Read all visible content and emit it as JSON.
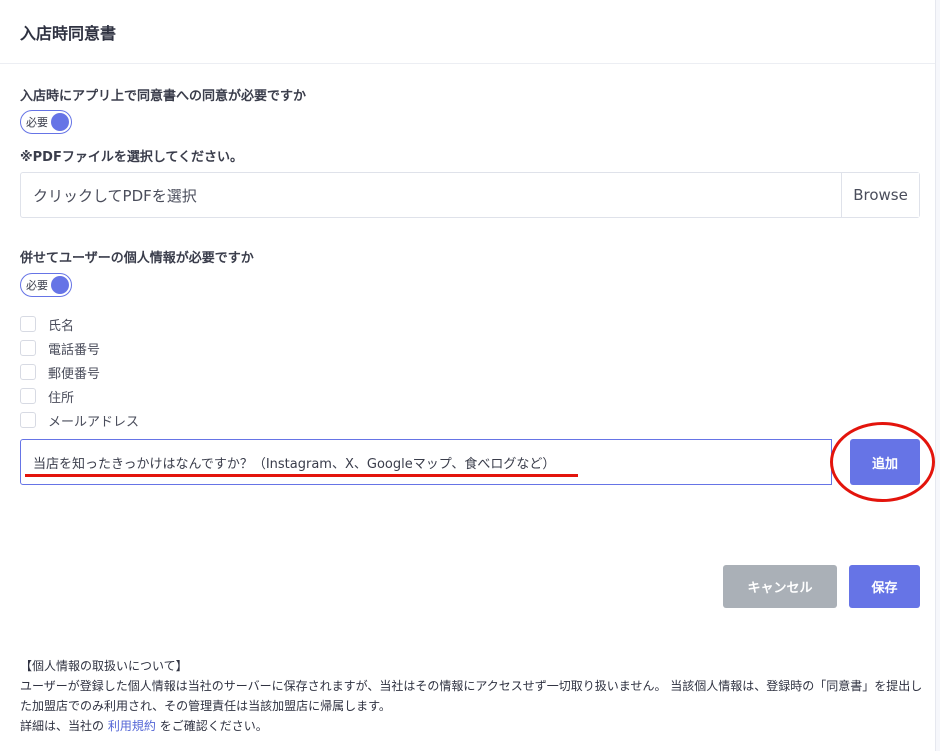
{
  "header": {
    "title": "入店時同意書"
  },
  "consent": {
    "question": "入店時にアプリ上で同意書への同意が必要ですか",
    "toggle_label": "必要",
    "pdf_instruction": "※PDFファイルを選択してください。",
    "file_placeholder": "クリックしてPDFを選択",
    "browse_label": "Browse"
  },
  "personal_info": {
    "question": "併せてユーザーの個人情報が必要ですか",
    "toggle_label": "必要",
    "fields": [
      {
        "label": "氏名",
        "checked": false
      },
      {
        "label": "電話番号",
        "checked": false
      },
      {
        "label": "郵便番号",
        "checked": false
      },
      {
        "label": "住所",
        "checked": false
      },
      {
        "label": "メールアドレス",
        "checked": false
      }
    ]
  },
  "custom_question": {
    "value": "当店を知ったきっかけはなんですか？（Instagram、X、Googleマップ、食べログなど）",
    "add_label": "追加"
  },
  "actions": {
    "cancel_label": "キャンセル",
    "save_label": "保存"
  },
  "notice": {
    "heading": "【個人情報の取扱いについて】",
    "body": "ユーザーが登録した個人情報は当社のサーバーに保存されますが、当社はその情報にアクセスせず一切取り扱いません。 当該個人情報は、登録時の「同意書」を提出した加盟店でのみ利用され、その管理責任は当該加盟店に帰属します。",
    "detail_prefix": "詳細は、当社の",
    "terms_link": "利用規約",
    "detail_suffix": "をご確認ください。"
  },
  "colors": {
    "accent": "#6674e6",
    "cancel": "#aab0b7",
    "annotation_red": "#e3140c"
  }
}
